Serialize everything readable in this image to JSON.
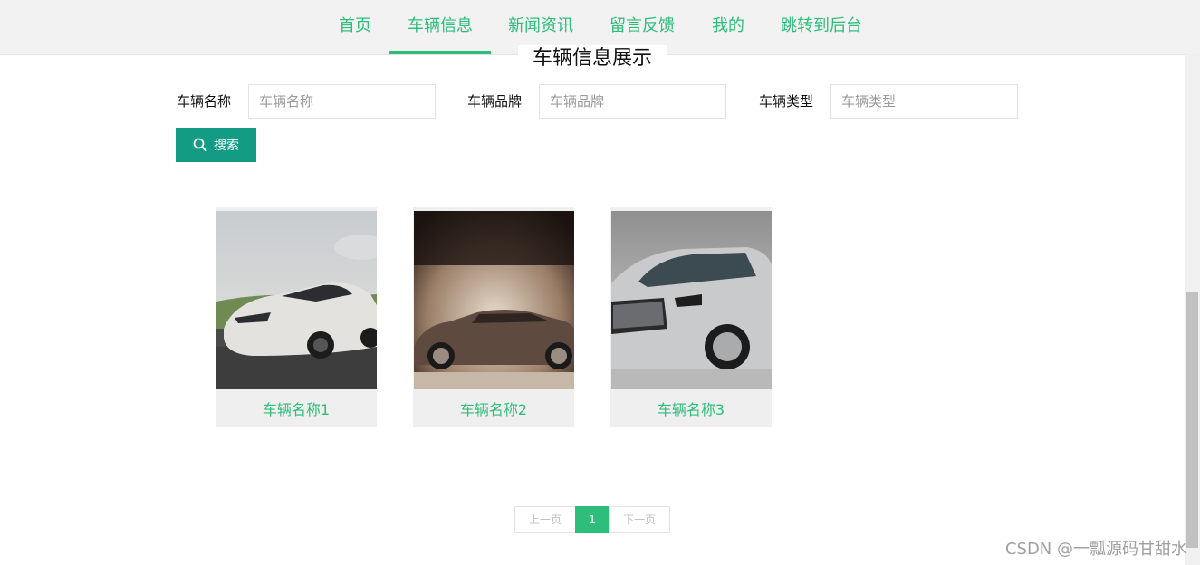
{
  "nav": {
    "items": [
      {
        "label": "首页"
      },
      {
        "label": "车辆信息"
      },
      {
        "label": "新闻资讯"
      },
      {
        "label": "留言反馈"
      },
      {
        "label": "我的"
      },
      {
        "label": "跳转到后台"
      }
    ],
    "active_index": 1
  },
  "section": {
    "title": "车辆信息展示"
  },
  "search": {
    "fields": [
      {
        "label": "车辆名称",
        "placeholder": "车辆名称",
        "value": ""
      },
      {
        "label": "车辆品牌",
        "placeholder": "车辆品牌",
        "value": ""
      },
      {
        "label": "车辆类型",
        "placeholder": "车辆类型",
        "value": ""
      }
    ],
    "button_label": "搜索",
    "button_icon": "search-icon"
  },
  "cars": [
    {
      "name": "车辆名称1",
      "image": "white-sports-car"
    },
    {
      "name": "车辆名称2",
      "image": "bronze-luxury-sedan"
    },
    {
      "name": "车辆名称3",
      "image": "silver-suv"
    }
  ],
  "pagination": {
    "prev_label": "上一页",
    "current_page": "1",
    "next_label": "下一页"
  },
  "watermark": "CSDN @一瓢源码甘甜水",
  "colors": {
    "accent": "#2ebd7b",
    "search_button": "#139b86",
    "nav_background": "#f2f2f2",
    "card_background": "#efefef"
  }
}
